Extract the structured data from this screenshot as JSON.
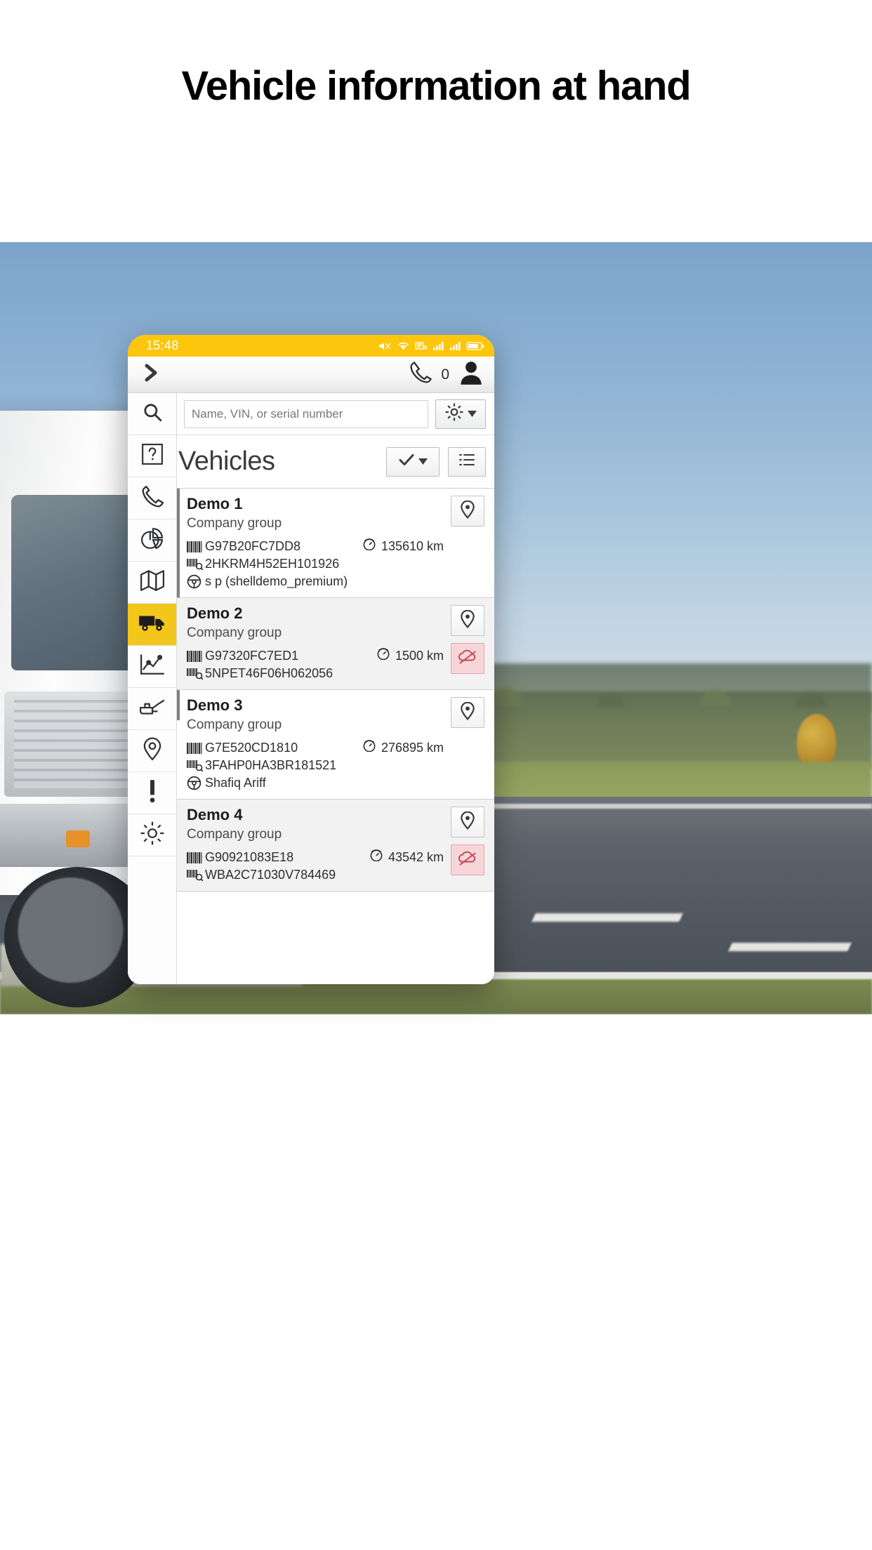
{
  "page": {
    "title": "Vehicle information at hand"
  },
  "phone": {
    "statusbar": {
      "clock": "15:48",
      "icons": [
        "mute-icon",
        "wifi-icon",
        "network-icon",
        "signal-1-icon",
        "signal-2-icon",
        "battery-icon"
      ]
    },
    "navbar": {
      "menu_icon": "chevron-right-icon",
      "call_icon": "phone-icon",
      "call_count": "0",
      "profile_icon": "user-avatar-icon"
    },
    "rail": [
      {
        "name": "search",
        "icon": "search-icon",
        "active": false
      },
      {
        "name": "help",
        "icon": "question-box-icon",
        "active": false
      },
      {
        "name": "calls",
        "icon": "phone-handset-icon",
        "active": false
      },
      {
        "name": "reports",
        "icon": "pie-chart-icon",
        "active": false
      },
      {
        "name": "map",
        "icon": "map-icon",
        "active": false
      },
      {
        "name": "vehicles",
        "icon": "truck-icon",
        "active": true
      },
      {
        "name": "analytics",
        "icon": "line-chart-icon",
        "active": false
      },
      {
        "name": "maintenance",
        "icon": "oil-can-icon",
        "active": false
      },
      {
        "name": "locations",
        "icon": "map-pin-icon",
        "active": false
      },
      {
        "name": "alerts",
        "icon": "exclamation-icon",
        "active": false
      },
      {
        "name": "settings",
        "icon": "gear-icon",
        "active": false
      }
    ],
    "search": {
      "placeholder": "Name, VIN, or serial number",
      "value": "",
      "settings_icon": "gear-icon",
      "settings_caret": "caret-down-icon"
    },
    "list_header": {
      "title": "Vehicles",
      "select_icon": "check-icon",
      "select_caret": "caret-down-icon",
      "view_icon": "list-view-icon"
    },
    "vehicles": [
      {
        "name": "Demo 1",
        "group": "Company group",
        "serial": "G97B20FC7DD8",
        "vin": "2HKRM4H52EH101926",
        "driver": "s p (shelldemo_premium)",
        "odometer": "135610 km",
        "pin_icon": "map-pin-icon",
        "blocked": false
      },
      {
        "name": "Demo 2",
        "group": "Company group",
        "serial": "G97320FC7ED1",
        "vin": "5NPET46F06H062056",
        "driver": "",
        "odometer": "1500 km",
        "pin_icon": "map-pin-icon",
        "blocked": true,
        "blocked_icon": "no-connection-icon"
      },
      {
        "name": "Demo 3",
        "group": "Company group",
        "serial": "G7E520CD1810",
        "vin": "3FAHP0HA3BR181521",
        "driver": "Shafiq Ariff",
        "odometer": "276895 km",
        "pin_icon": "map-pin-icon",
        "blocked": false
      },
      {
        "name": "Demo 4",
        "group": "Company group",
        "serial": "G90921083E18",
        "vin": "WBA2C71030V784469",
        "driver": "",
        "odometer": "43542 km",
        "pin_icon": "map-pin-icon",
        "blocked": true,
        "blocked_icon": "no-connection-icon"
      }
    ],
    "icon_labels": {
      "serial": "barcode-icon",
      "vin": "vin-plate-icon",
      "driver": "steering-wheel-icon",
      "odometer": "gauge-icon"
    }
  },
  "colors": {
    "accent_yellow": "#fcc60d",
    "rail_active": "#f2c61b",
    "blocked_bg": "#f6d6d9",
    "blocked_border": "#e3a3a8",
    "text_dark": "#1d1d1d"
  }
}
